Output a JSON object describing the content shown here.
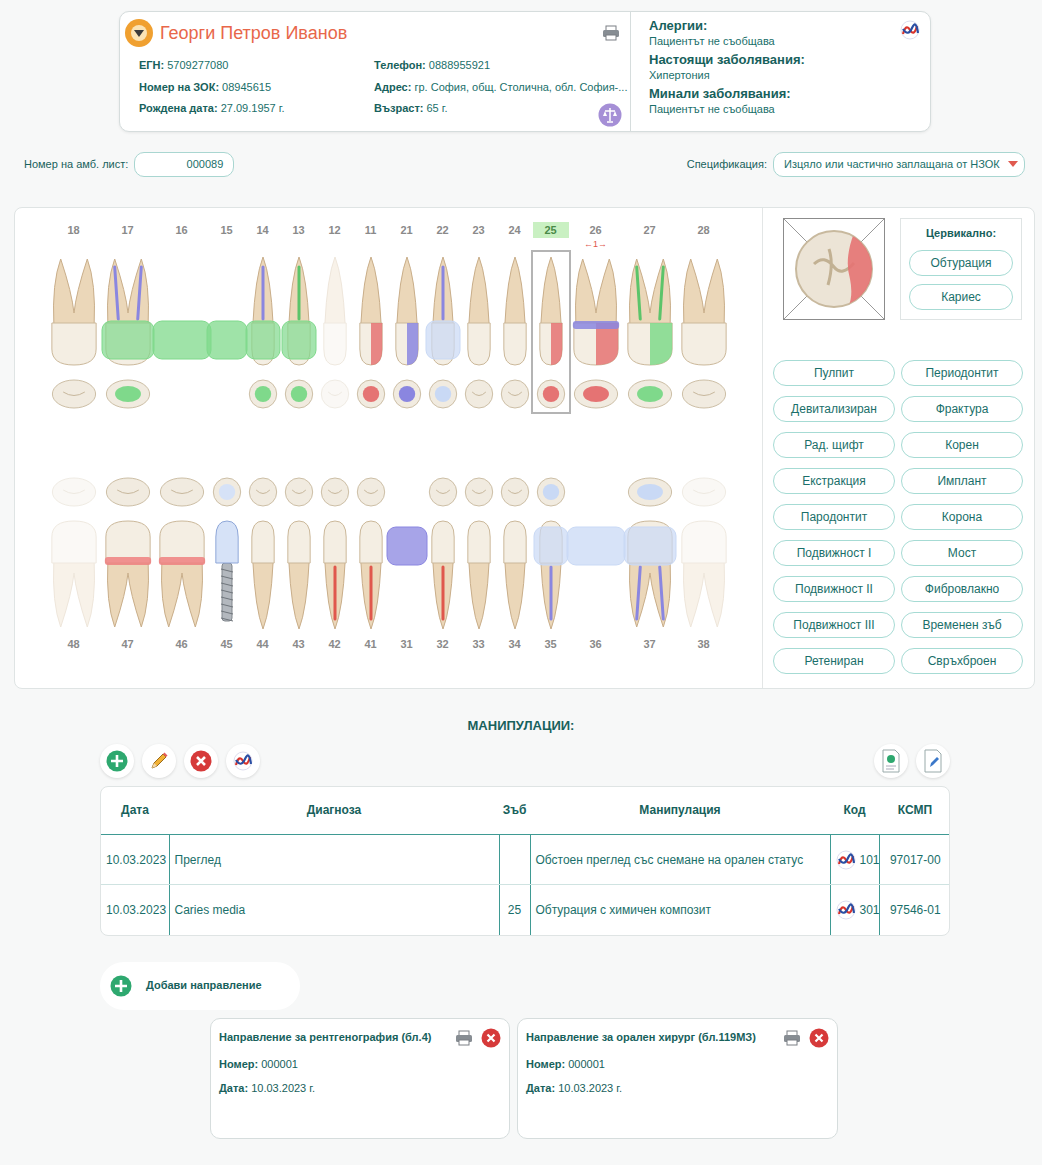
{
  "patient": {
    "name": "Георги Петров Иванов",
    "fields": [
      {
        "label": "ЕГН:",
        "value": "5709277080"
      },
      {
        "label": "Телефон:",
        "value": "0888955921"
      },
      {
        "label": "Номер на ЗОК:",
        "value": "08945615"
      },
      {
        "label": "Адрес:",
        "value": "гр. София, общ. Столична, обл. София-..."
      },
      {
        "label": "Рождена дата:",
        "value": "27.09.1957 г."
      },
      {
        "label": "Възраст:",
        "value": "65 г."
      }
    ],
    "history": [
      {
        "label": "Алергии:",
        "value": "Пациентът не съобщава"
      },
      {
        "label": "Настоящи заболявания:",
        "value": "Хипертония"
      },
      {
        "label": "Минали заболявания:",
        "value": "Пациентът не съобщава"
      }
    ]
  },
  "sheet": {
    "label": "Номер на амб. лист:",
    "value": "000089"
  },
  "specification": {
    "label": "Спецификация:",
    "value": "Изцяло или частично заплащана от НЗОК"
  },
  "chart": {
    "upper": [
      {
        "number": "18",
        "selected": false,
        "kind": "normal",
        "crown": "",
        "root": "",
        "band": "",
        "marker": ""
      },
      {
        "number": "17",
        "selected": false,
        "kind": "bridge",
        "crown": "#7fd98b",
        "root": "#8a86e0",
        "band": "",
        "marker": ""
      },
      {
        "number": "16",
        "selected": false,
        "kind": "pontic",
        "crown": "#7fd98b",
        "root": "",
        "band": "",
        "marker": ""
      },
      {
        "number": "15",
        "selected": false,
        "kind": "pontic",
        "crown": "#7fd98b",
        "root": "",
        "band": "",
        "marker": ""
      },
      {
        "number": "14",
        "selected": false,
        "kind": "bridge",
        "crown": "#7fd98b",
        "root": "#8a86e0",
        "band": "",
        "marker": ""
      },
      {
        "number": "13",
        "selected": false,
        "kind": "bridge",
        "crown": "#7fd98b",
        "root": "#5cc46a",
        "band": "",
        "marker": ""
      },
      {
        "number": "12",
        "selected": false,
        "kind": "faded",
        "crown": "",
        "root": "",
        "band": "",
        "marker": ""
      },
      {
        "number": "11",
        "selected": false,
        "kind": "normal",
        "crown": "#e57373",
        "root": "",
        "band": "",
        "marker": ""
      },
      {
        "number": "21",
        "selected": false,
        "kind": "normal",
        "crown": "#8a86e0",
        "root": "",
        "band": "",
        "marker": ""
      },
      {
        "number": "22",
        "selected": false,
        "kind": "bridge",
        "crown": "#c9d9f5",
        "root": "#8a86e0",
        "band": "",
        "marker": ""
      },
      {
        "number": "23",
        "selected": false,
        "kind": "normal",
        "crown": "",
        "root": "",
        "band": "",
        "marker": ""
      },
      {
        "number": "24",
        "selected": false,
        "kind": "normal",
        "crown": "",
        "root": "",
        "band": "",
        "marker": ""
      },
      {
        "number": "25",
        "selected": true,
        "kind": "normal",
        "crown": "#e57373",
        "root": "",
        "band": "",
        "marker": ""
      },
      {
        "number": "26",
        "selected": false,
        "kind": "normal",
        "crown": "#e57373",
        "root": "",
        "band": "#8a86e0",
        "marker": "←1→"
      },
      {
        "number": "27",
        "selected": false,
        "kind": "normal",
        "crown": "#7fd98b",
        "root": "#5cc46a",
        "band": "",
        "marker": ""
      },
      {
        "number": "28",
        "selected": false,
        "kind": "normal",
        "crown": "",
        "root": "",
        "band": "",
        "marker": ""
      }
    ],
    "lower": [
      {
        "number": "48",
        "selected": false,
        "kind": "faded",
        "crown": "",
        "root": "",
        "band": "",
        "marker": ""
      },
      {
        "number": "47",
        "selected": false,
        "kind": "normal",
        "crown": "",
        "root": "",
        "band": "#ef8080",
        "marker": ""
      },
      {
        "number": "46",
        "selected": false,
        "kind": "normal",
        "crown": "",
        "root": "",
        "band": "#ef8080",
        "marker": ""
      },
      {
        "number": "45",
        "selected": false,
        "kind": "implant",
        "crown": "#d6e2f7",
        "root": "",
        "band": "",
        "marker": ""
      },
      {
        "number": "44",
        "selected": false,
        "kind": "normal",
        "crown": "",
        "root": "",
        "band": "",
        "marker": ""
      },
      {
        "number": "43",
        "selected": false,
        "kind": "normal",
        "crown": "",
        "root": "",
        "band": "",
        "marker": ""
      },
      {
        "number": "42",
        "selected": false,
        "kind": "normal",
        "crown": "",
        "root": "#e0574c",
        "band": "",
        "marker": ""
      },
      {
        "number": "41",
        "selected": false,
        "kind": "normal",
        "crown": "",
        "root": "#e0574c",
        "band": "",
        "marker": ""
      },
      {
        "number": "31",
        "selected": false,
        "kind": "pontic",
        "crown": "#8a86e0",
        "root": "",
        "band": "",
        "marker": ""
      },
      {
        "number": "32",
        "selected": false,
        "kind": "normal",
        "crown": "",
        "root": "#e0574c",
        "band": "",
        "marker": ""
      },
      {
        "number": "33",
        "selected": false,
        "kind": "normal",
        "crown": "",
        "root": "",
        "band": "",
        "marker": ""
      },
      {
        "number": "34",
        "selected": false,
        "kind": "normal",
        "crown": "",
        "root": "",
        "band": "",
        "marker": ""
      },
      {
        "number": "35",
        "selected": false,
        "kind": "bridge",
        "crown": "#c9d9f5",
        "root": "#8a86e0",
        "band": "",
        "marker": ""
      },
      {
        "number": "36",
        "selected": false,
        "kind": "pontic",
        "crown": "#c9d9f5",
        "root": "",
        "band": "",
        "marker": ""
      },
      {
        "number": "37",
        "selected": false,
        "kind": "bridge",
        "crown": "#c9d9f5",
        "root": "#8a86e0",
        "band": "",
        "marker": ""
      },
      {
        "number": "38",
        "selected": false,
        "kind": "faded",
        "crown": "",
        "root": "",
        "band": "",
        "marker": ""
      }
    ]
  },
  "cervical": {
    "title": "Цервикално:",
    "buttons": [
      "Обтурация",
      "Кариес"
    ]
  },
  "conditions": [
    "Пулпит",
    "Периодонтит",
    "Девитализиран",
    "Фрактура",
    "Рад. щифт",
    "Корен",
    "Екстракция",
    "Имплант",
    "Пародонтит",
    "Корона",
    "Подвижност I",
    "Мост",
    "Подвижност II",
    "Фибровлакно",
    "Подвижност III",
    "Временен зъб",
    "Ретениран",
    "Свръхброен"
  ],
  "manipulations": {
    "title": "МАНИПУЛАЦИИ:",
    "columns": [
      "Дата",
      "Диагноза",
      "Зъб",
      "Манипулация",
      "Код",
      "КСМП"
    ],
    "rows": [
      [
        "10.03.2023",
        "Преглед",
        "",
        "Обстоен преглед със снемане на орален статус",
        "101",
        "97017-00"
      ],
      [
        "10.03.2023",
        "Caries media",
        "25",
        "Обтурация с химичен композит",
        "301",
        "97546-01"
      ]
    ]
  },
  "referrals": {
    "add_label": "Добави направление",
    "items": [
      {
        "title": "Направление за рентгенография (бл.4)",
        "number_label": "Номер:",
        "number": "000001",
        "date_label": "Дата:",
        "date": "10.03.2023 г."
      },
      {
        "title": "Направление за орален хирург (бл.119МЗ)",
        "number_label": "Номер:",
        "number": "000001",
        "date_label": "Дата:",
        "date": "10.03.2023 г."
      }
    ]
  }
}
